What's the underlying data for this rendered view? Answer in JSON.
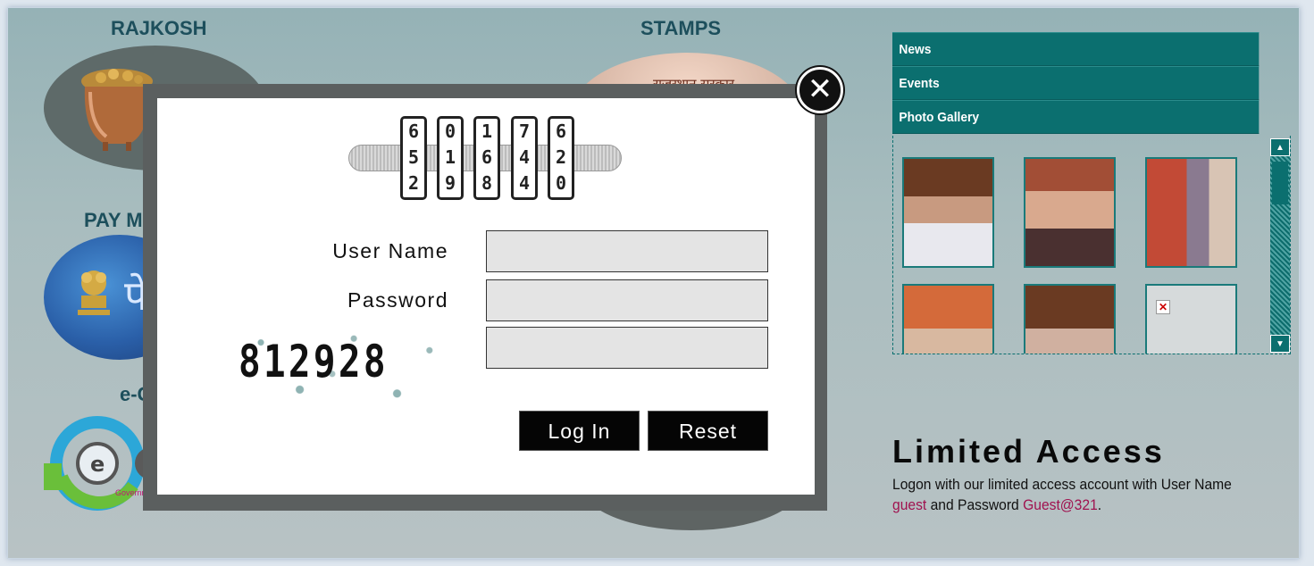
{
  "background": {
    "sections": {
      "rajkosh": "RAJKOSH",
      "stamps": "STAMPS",
      "pay_manager": "PAY M",
      "egov": "e-G"
    },
    "stamps_hindi": "राजस्थान सरकार",
    "pay_hindi": "पे-",
    "egov_caption": "Governm"
  },
  "sidebar": {
    "items": [
      {
        "label": "News"
      },
      {
        "label": "Events"
      },
      {
        "label": "Photo Gallery"
      }
    ],
    "gallery_thumbnails": 6
  },
  "limited_access": {
    "title": "Limited Access",
    "text_before": "Logon with our limited access account with User Name ",
    "username": "guest",
    "text_middle": " and Password ",
    "password": "Guest@321",
    "text_end": "."
  },
  "login_modal": {
    "close_glyph": "✕",
    "lock_dials": [
      [
        "6",
        "5",
        "2"
      ],
      [
        "0",
        "1",
        "9"
      ],
      [
        "1",
        "6",
        "8"
      ],
      [
        "7",
        "4",
        "4"
      ],
      [
        "6",
        "2",
        "0"
      ]
    ],
    "username_label": "User Name",
    "password_label": "Password",
    "username_value": "",
    "password_value": "",
    "captcha_value": "",
    "captcha_text": "812928",
    "login_button": "Log In",
    "reset_button": "Reset"
  },
  "colors": {
    "accent": "#0b6f6f",
    "highlight": "#a0124f"
  }
}
